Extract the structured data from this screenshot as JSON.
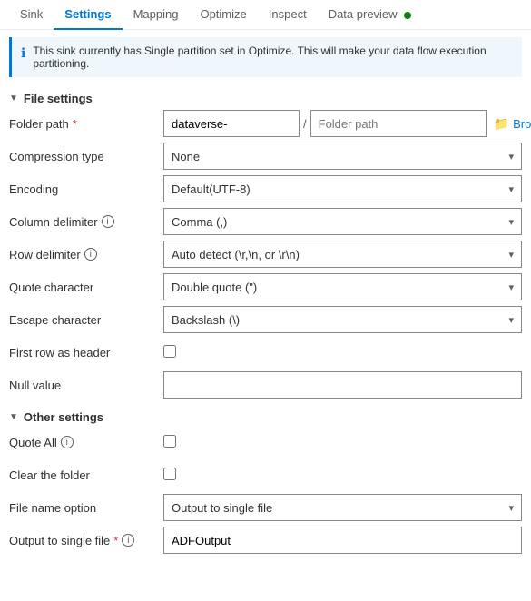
{
  "tabs": [
    {
      "id": "sink",
      "label": "Sink",
      "active": false
    },
    {
      "id": "settings",
      "label": "Settings",
      "active": true
    },
    {
      "id": "mapping",
      "label": "Mapping",
      "active": false
    },
    {
      "id": "optimize",
      "label": "Optimize",
      "active": false
    },
    {
      "id": "inspect",
      "label": "Inspect",
      "active": false
    },
    {
      "id": "data-preview",
      "label": "Data preview",
      "active": false,
      "dot": true
    }
  ],
  "banner": {
    "text": "This sink currently has Single partition set in Optimize. This will make your data flow execution partitioning."
  },
  "file_settings": {
    "header": "File settings",
    "folder_path": {
      "label": "Folder path",
      "required": true,
      "main_value": "dataverse-",
      "path_placeholder": "Folder path",
      "browse_label": "Browse"
    },
    "compression_type": {
      "label": "Compression type",
      "value": "None"
    },
    "encoding": {
      "label": "Encoding",
      "value": "Default(UTF-8)"
    },
    "column_delimiter": {
      "label": "Column delimiter",
      "value": "Comma (,)",
      "has_info": true
    },
    "row_delimiter": {
      "label": "Row delimiter",
      "value": "Auto detect (\\r,\\n, or \\r\\n)",
      "has_info": true
    },
    "quote_character": {
      "label": "Quote character",
      "value": "Double quote (\")"
    },
    "escape_character": {
      "label": "Escape character",
      "value": "Backslash (\\)"
    },
    "first_row_as_header": {
      "label": "First row as header",
      "checked": false
    },
    "null_value": {
      "label": "Null value",
      "value": ""
    }
  },
  "other_settings": {
    "header": "Other settings",
    "quote_all": {
      "label": "Quote All",
      "has_info": true,
      "checked": false
    },
    "clear_the_folder": {
      "label": "Clear the folder",
      "checked": false
    },
    "file_name_option": {
      "label": "File name option",
      "value": "Output to single file"
    },
    "output_to_single_file": {
      "label": "Output to single file",
      "required": true,
      "has_info": true,
      "value": "ADFOutput"
    }
  }
}
